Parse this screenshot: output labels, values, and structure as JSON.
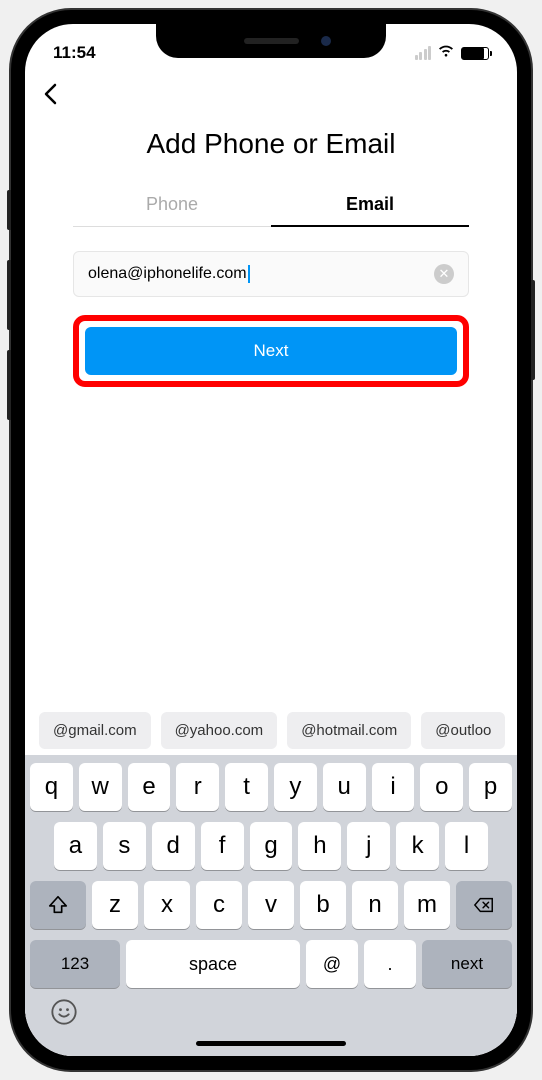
{
  "status": {
    "time": "11:54"
  },
  "page": {
    "title": "Add Phone or Email"
  },
  "tabs": {
    "phone_label": "Phone",
    "email_label": "Email"
  },
  "form": {
    "email_value": "olena@iphonelife.com",
    "clear_glyph": "✕",
    "next_label": "Next"
  },
  "suggestions": [
    "@gmail.com",
    "@yahoo.com",
    "@hotmail.com",
    "@outloo"
  ],
  "keyboard": {
    "row1": [
      "q",
      "w",
      "e",
      "r",
      "t",
      "y",
      "u",
      "i",
      "o",
      "p"
    ],
    "row2": [
      "a",
      "s",
      "d",
      "f",
      "g",
      "h",
      "j",
      "k",
      "l"
    ],
    "row3": [
      "z",
      "x",
      "c",
      "v",
      "b",
      "n",
      "m"
    ],
    "k123": "123",
    "space": "space",
    "at": "@",
    "dot": ".",
    "next": "next"
  }
}
